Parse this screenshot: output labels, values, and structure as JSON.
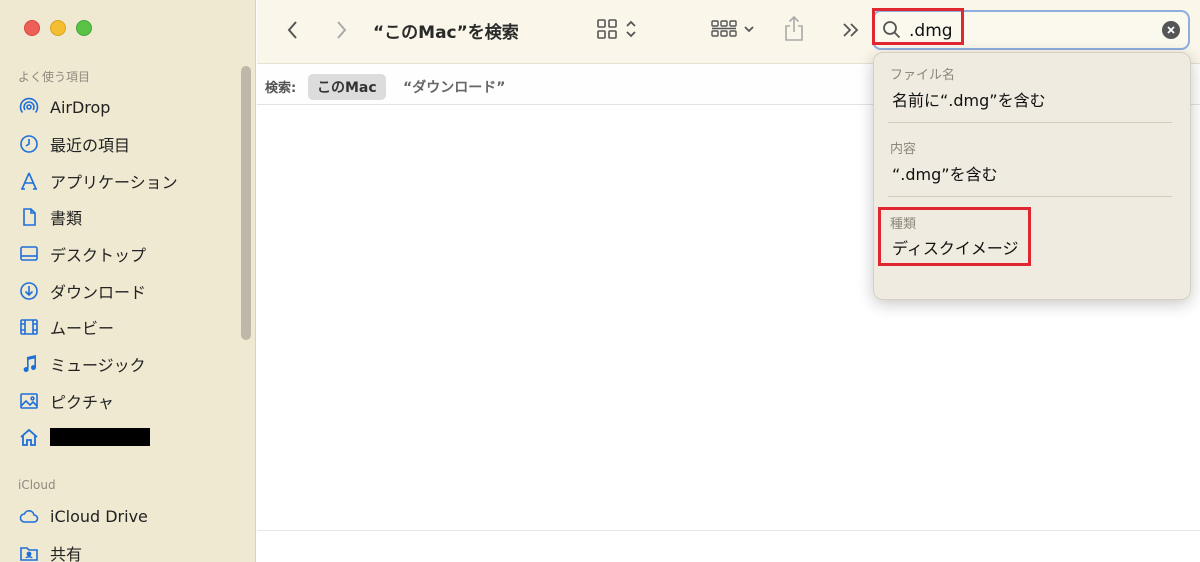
{
  "window": {
    "title": "“このMac”を検索"
  },
  "sidebar": {
    "favorites_label": "よく使う項目",
    "favorites": [
      {
        "label": "AirDrop",
        "icon": "airdrop-icon"
      },
      {
        "label": "最近の項目",
        "icon": "clock-icon"
      },
      {
        "label": "アプリケーション",
        "icon": "applications-icon"
      },
      {
        "label": "書類",
        "icon": "document-icon"
      },
      {
        "label": "デスクトップ",
        "icon": "desktop-icon"
      },
      {
        "label": "ダウンロード",
        "icon": "download-icon"
      },
      {
        "label": "ムービー",
        "icon": "film-icon"
      },
      {
        "label": "ミュージック",
        "icon": "music-icon"
      },
      {
        "label": "ピクチャ",
        "icon": "photo-icon"
      },
      {
        "label": "",
        "icon": "home-icon"
      }
    ],
    "icloud_label": "iCloud",
    "icloud": [
      {
        "label": "iCloud Drive",
        "icon": "cloud-icon"
      },
      {
        "label": "共有",
        "icon": "shared-folder-icon"
      }
    ]
  },
  "search": {
    "value": ".dmg"
  },
  "scope": {
    "label": "検索:",
    "active": "このMac",
    "other": "“ダウンロード”"
  },
  "suggestions": {
    "filename_header": "ファイル名",
    "filename_item": "名前に“.dmg”を含む",
    "content_header": "内容",
    "content_item": "“.dmg”を含む",
    "kind_header": "種類",
    "kind_item": "ディスクイメージ"
  },
  "colors": {
    "accent": "#1e6fd9",
    "highlight": "#e0262e",
    "sidebar_bg": "#efe9d2"
  }
}
